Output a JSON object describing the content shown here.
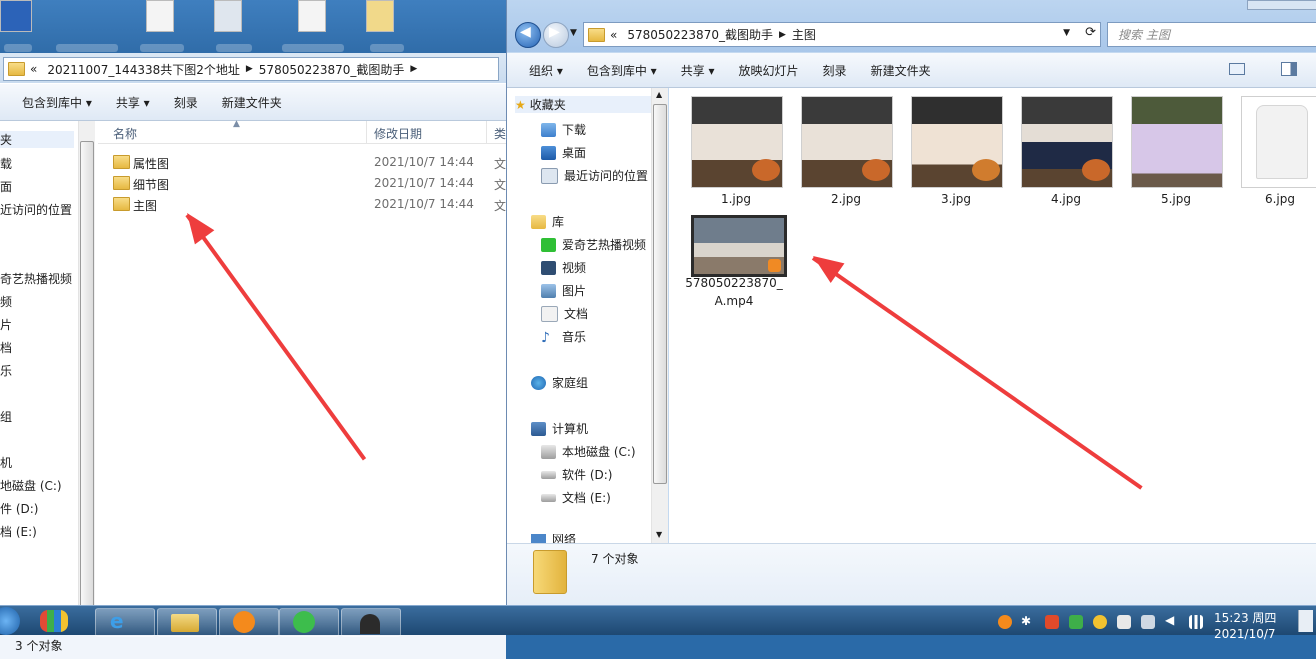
{
  "left_window": {
    "breadcrumb": [
      "«",
      "20211007_144338共下图2个地址",
      "578050223870_截图助手"
    ],
    "toolbar": [
      "包含到库中 ▾",
      "共享 ▾",
      "刻录",
      "新建文件夹"
    ],
    "nav_items": [
      "夹",
      "载",
      "面",
      "近访问的位置",
      "奇艺热播视频",
      "频",
      "片",
      "档",
      "乐",
      "组",
      "机",
      "地磁盘 (C:)",
      "件 (D:)",
      "档 (E:)"
    ],
    "columns": {
      "name": "名称",
      "date": "修改日期",
      "type": "类"
    },
    "rows": [
      {
        "name": "属性图",
        "date": "2021/10/7 14:44",
        "type": "文"
      },
      {
        "name": "细节图",
        "date": "2021/10/7 14:44",
        "type": "文"
      },
      {
        "name": "主图",
        "date": "2021/10/7 14:44",
        "type": "文"
      }
    ],
    "status": "3 个对象"
  },
  "right_window": {
    "breadcrumb": [
      "«",
      "578050223870_截图助手",
      "主图"
    ],
    "search_placeholder": "搜索 主图",
    "toolbar": [
      "组织 ▾",
      "包含到库中 ▾",
      "共享 ▾",
      "放映幻灯片",
      "刻录",
      "新建文件夹"
    ],
    "nav": {
      "favorites": "收藏夹",
      "favorite_items": [
        "下载",
        "桌面",
        "最近访问的位置"
      ],
      "libraries": "库",
      "library_items": [
        "爱奇艺热播视频",
        "视频",
        "图片",
        "文档",
        "音乐"
      ],
      "homegroup": "家庭组",
      "computer": "计算机",
      "drives": [
        "本地磁盘 (C:)",
        "软件 (D:)",
        "文档 (E:)"
      ],
      "network": "网络"
    },
    "files": [
      {
        "name": "1.jpg",
        "kind": "photo"
      },
      {
        "name": "2.jpg",
        "kind": "photo"
      },
      {
        "name": "3.jpg",
        "kind": "photo"
      },
      {
        "name": "4.jpg",
        "kind": "photo"
      },
      {
        "name": "5.jpg",
        "kind": "photo"
      },
      {
        "name": "6.jpg",
        "kind": "photo"
      },
      {
        "name": "578050223870_A.mp4",
        "name_line1": "578050223870_",
        "name_line2": "A.mp4",
        "kind": "video"
      }
    ],
    "details": "7 个对象"
  },
  "taskbar": {
    "time": "15:23 周四",
    "date": "2021/10/7"
  },
  "colors": {
    "accent": "#ee3d3d",
    "taskbar": "#1e4872",
    "chrome": "#c4d9f0"
  }
}
